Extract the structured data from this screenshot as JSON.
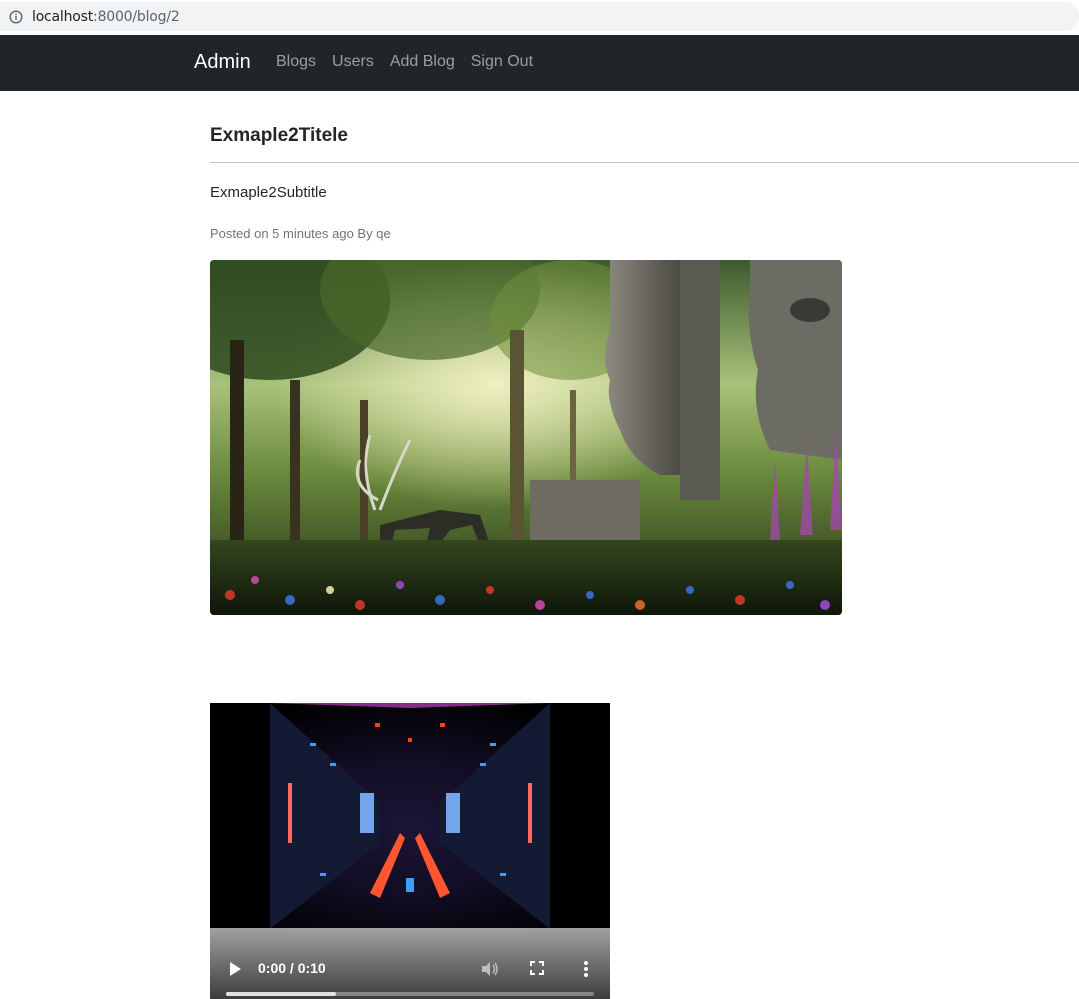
{
  "browser": {
    "url_host": "localhost",
    "url_rest": ":8000/blog/2",
    "info_icon": "info-icon"
  },
  "navbar": {
    "brand": "Admin",
    "links": [
      "Blogs",
      "Users",
      "Add Blog",
      "Sign Out"
    ]
  },
  "post": {
    "title": "Exmaple2Titele",
    "subtitle": "Exmaple2Subtitle",
    "meta": "Posted on 5 minutes ago By qe",
    "image_icon": "forest-scene-image"
  },
  "video": {
    "time": "0:00 / 0:10",
    "progress": 0.3,
    "icons": [
      "play-icon",
      "volume-icon",
      "fullscreen-icon",
      "more-options-icon"
    ]
  },
  "colors": {
    "navbar_bg": "#212529",
    "brand": "#ffffff",
    "nav_link": "rgba(255,255,255,0.55)",
    "meta_text": "#6c757d"
  }
}
